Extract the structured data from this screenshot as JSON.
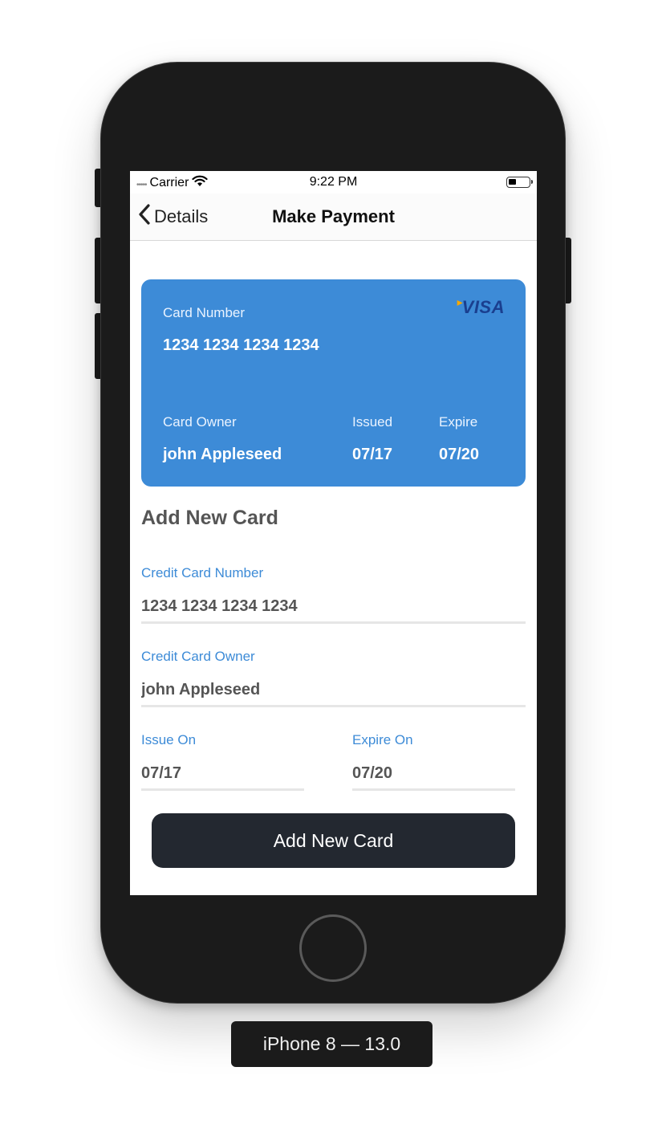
{
  "device_label": "iPhone 8 — 13.0",
  "status_bar": {
    "carrier": "Carrier",
    "time": "9:22 PM"
  },
  "nav": {
    "back_label": "Details",
    "title": "Make Payment"
  },
  "card": {
    "brand": "VISA",
    "number_label": "Card Number",
    "number": "1234 1234 1234 1234",
    "owner_label": "Card Owner",
    "owner": "john Appleseed",
    "issued_label": "Issued",
    "issued": "07/17",
    "expire_label": "Expire",
    "expire": "07/20",
    "color": "#3d8bd7"
  },
  "form": {
    "title": "Add New Card",
    "card_number_label": "Credit Card Number",
    "card_number_value": "1234 1234 1234 1234",
    "card_owner_label": "Credit Card Owner",
    "card_owner_value": "john Appleseed",
    "issue_label": "Issue On",
    "issue_value": "07/17",
    "expire_label": "Expire On",
    "expire_value": "07/20",
    "submit_label": "Add New Card"
  },
  "colors": {
    "accent": "#3d8bd7",
    "button": "#232830",
    "device": "#1b1b1b"
  }
}
